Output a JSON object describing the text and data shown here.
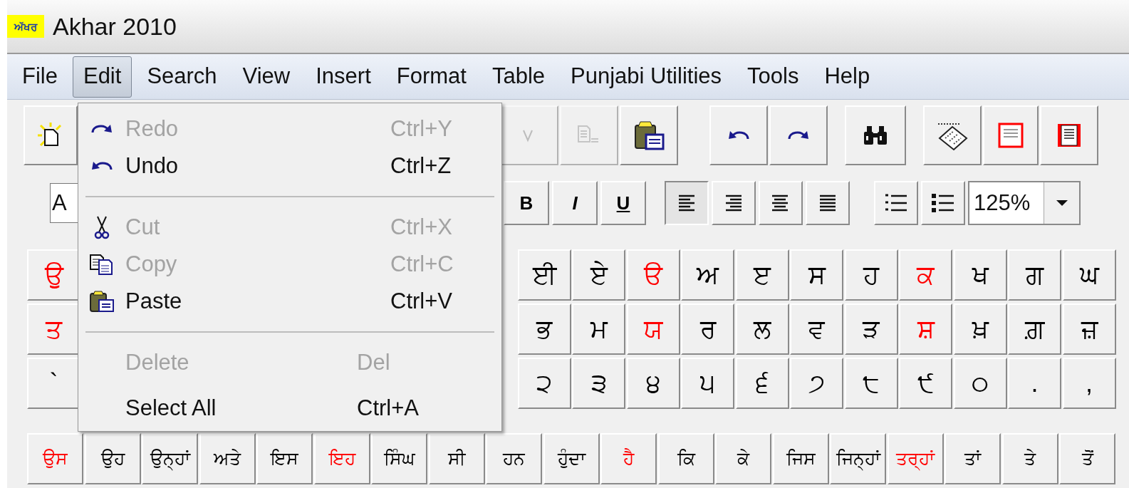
{
  "window": {
    "logo_text": "ਅੱਖਰ",
    "title": "Akhar 2010"
  },
  "menu_bar": [
    {
      "label": "File",
      "selected": false
    },
    {
      "label": "Edit",
      "selected": true
    },
    {
      "label": "Search",
      "selected": false
    },
    {
      "label": "View",
      "selected": false
    },
    {
      "label": "Insert",
      "selected": false
    },
    {
      "label": "Format",
      "selected": false
    },
    {
      "label": "Table",
      "selected": false
    },
    {
      "label": "Punjabi Utilities",
      "selected": false
    },
    {
      "label": "Tools",
      "selected": false
    },
    {
      "label": "Help",
      "selected": false
    }
  ],
  "edit_menu": [
    {
      "kind": "item",
      "label": "Redo",
      "shortcut": "Ctrl+Y",
      "disabled": true
    },
    {
      "kind": "item",
      "label": "Undo",
      "shortcut": "Ctrl+Z",
      "disabled": false
    },
    {
      "kind": "separator"
    },
    {
      "kind": "item",
      "label": "Cut",
      "shortcut": "Ctrl+X",
      "disabled": true
    },
    {
      "kind": "item",
      "label": "Copy",
      "shortcut": "Ctrl+C",
      "disabled": true
    },
    {
      "kind": "item",
      "label": "Paste",
      "shortcut": "Ctrl+V",
      "disabled": false
    },
    {
      "kind": "separator"
    },
    {
      "kind": "item",
      "label": "Delete",
      "shortcut": "Del",
      "disabled": true
    },
    {
      "kind": "item",
      "label": "Select All",
      "shortcut": "Ctrl+A",
      "disabled": false
    }
  ],
  "toolbar": {
    "buttons": [
      {
        "disabled": false
      },
      {
        "disabled": true
      },
      {
        "disabled": true
      },
      {
        "disabled": false
      },
      {
        "disabled": false
      },
      {
        "disabled": false
      },
      {
        "disabled": false
      },
      {
        "disabled": false
      },
      {
        "disabled": false
      },
      {
        "disabled": false
      }
    ]
  },
  "format_bar": {
    "font_field": {
      "value": "A"
    },
    "style_buttons": [
      {
        "label": "B"
      },
      {
        "label": "I"
      },
      {
        "label": "U"
      }
    ],
    "align_buttons": [
      {
        "selected": true
      },
      {
        "selected": false
      },
      {
        "selected": false
      },
      {
        "selected": false
      }
    ],
    "list_buttons": [
      {
        "selected": false
      },
      {
        "selected": false
      }
    ],
    "zoom": {
      "value": "125%"
    }
  },
  "keyboard": {
    "rows": [
      {
        "left": [
          {
            "label": "ਉ",
            "color": "#ff0000"
          }
        ],
        "right": [
          {
            "label": "ਈ",
            "color": "#000000"
          },
          {
            "label": "ਏ",
            "color": "#000000"
          },
          {
            "label": "ੳ",
            "color": "#ff0000"
          },
          {
            "label": "ਅ",
            "color": "#000000"
          },
          {
            "label": "ੲ",
            "color": "#000000"
          },
          {
            "label": "ਸ",
            "color": "#000000"
          },
          {
            "label": "ਹ",
            "color": "#000000"
          },
          {
            "label": "ਕ",
            "color": "#ff0000"
          },
          {
            "label": "ਖ",
            "color": "#000000"
          },
          {
            "label": "ਗ",
            "color": "#000000"
          },
          {
            "label": "ਘ",
            "color": "#000000"
          }
        ]
      },
      {
        "left": [
          {
            "label": "ਤ",
            "color": "#ff0000"
          }
        ],
        "right": [
          {
            "label": "ਭ",
            "color": "#000000"
          },
          {
            "label": "ਮ",
            "color": "#000000"
          },
          {
            "label": "ਯ",
            "color": "#ff0000"
          },
          {
            "label": "ਰ",
            "color": "#000000"
          },
          {
            "label": "ਲ",
            "color": "#000000"
          },
          {
            "label": "ਵ",
            "color": "#000000"
          },
          {
            "label": "ੜ",
            "color": "#000000"
          },
          {
            "label": "ਸ਼",
            "color": "#ff0000"
          },
          {
            "label": "ਖ਼",
            "color": "#000000"
          },
          {
            "label": "ਗ਼",
            "color": "#000000"
          },
          {
            "label": "ਜ਼",
            "color": "#000000"
          }
        ]
      },
      {
        "left": [
          {
            "label": "`",
            "color": "#000000"
          }
        ],
        "right": [
          {
            "label": "੨",
            "color": "#000000"
          },
          {
            "label": "੩",
            "color": "#000000"
          },
          {
            "label": "੪",
            "color": "#000000"
          },
          {
            "label": "੫",
            "color": "#000000"
          },
          {
            "label": "੬",
            "color": "#000000"
          },
          {
            "label": "੭",
            "color": "#000000"
          },
          {
            "label": "੮",
            "color": "#000000"
          },
          {
            "label": "੯",
            "color": "#000000"
          },
          {
            "label": "੦",
            "color": "#000000"
          },
          {
            "label": ".",
            "color": "#000000"
          },
          {
            "label": ",",
            "color": "#000000"
          }
        ]
      }
    ],
    "words": [
      {
        "label": "ਉਸ",
        "color": "#ff0000"
      },
      {
        "label": "ਉਹ",
        "color": "#000000"
      },
      {
        "label": "ਉਨ੍ਹਾਂ",
        "color": "#000000"
      },
      {
        "label": "ਅਤੇ",
        "color": "#000000"
      },
      {
        "label": "ਇਸ",
        "color": "#000000"
      },
      {
        "label": "ਇਹ",
        "color": "#ff0000"
      },
      {
        "label": "ਸਿੰਘ",
        "color": "#000000"
      },
      {
        "label": "ਸੀ",
        "color": "#000000"
      },
      {
        "label": "ਹਨ",
        "color": "#000000"
      },
      {
        "label": "ਹੁੰਦਾ",
        "color": "#000000"
      },
      {
        "label": "ਹੈ",
        "color": "#ff0000"
      },
      {
        "label": "ਕਿ",
        "color": "#000000"
      },
      {
        "label": "ਕੇ",
        "color": "#000000"
      },
      {
        "label": "ਜਿਸ",
        "color": "#000000"
      },
      {
        "label": "ਜਿਨ੍ਹਾਂ",
        "color": "#000000"
      },
      {
        "label": "ਤਰ੍ਹਾਂ",
        "color": "#ff0000"
      },
      {
        "label": "ਤਾਂ",
        "color": "#000000"
      },
      {
        "label": "ਤੇ",
        "color": "#000000"
      },
      {
        "label": "ਤੋਂ",
        "color": "#000000"
      }
    ]
  }
}
